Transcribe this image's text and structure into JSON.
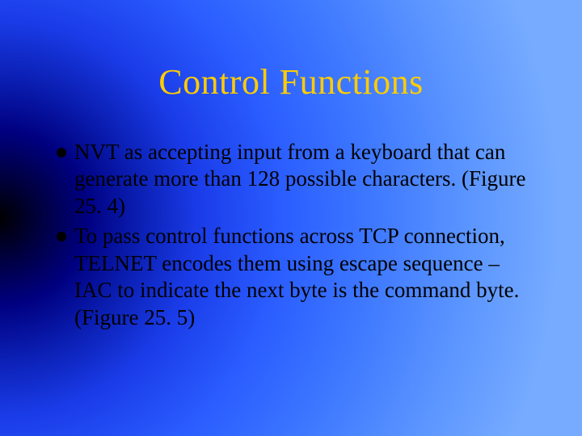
{
  "title": "Control Functions",
  "bullets": [
    {
      "text": "NVT as accepting input from a keyboard that can generate more than 128 possible characters. (Figure 25. 4)"
    },
    {
      "text": "To pass control functions across TCP connection, TELNET encodes them using escape sequence – IAC to indicate the next byte is the command byte. (Figure 25. 5)"
    }
  ]
}
